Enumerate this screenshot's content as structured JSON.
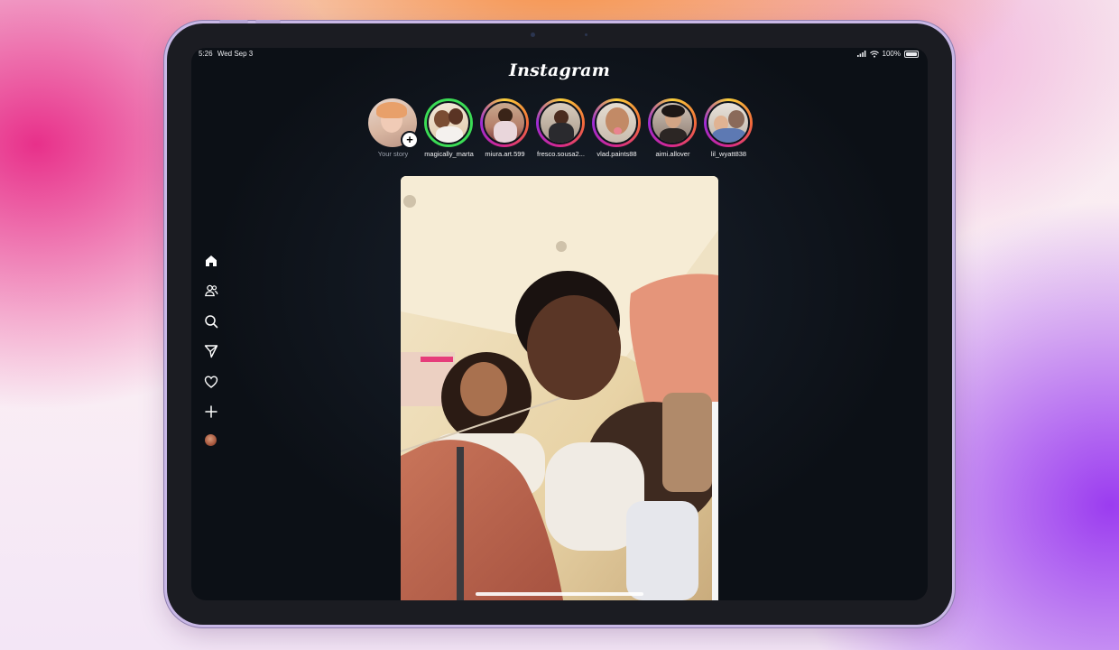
{
  "status_bar": {
    "time": "5:26",
    "date": "Wed Sep 3",
    "battery": "100%"
  },
  "app": {
    "logo": "Instagram"
  },
  "stories": [
    {
      "name": "Your story",
      "ring": "none",
      "self": true
    },
    {
      "name": "magically_marta",
      "ring": "close-friends"
    },
    {
      "name": "miura.art.599",
      "ring": "gradient"
    },
    {
      "name": "fresco.sousa2...",
      "ring": "gradient"
    },
    {
      "name": "vlad.paints88",
      "ring": "gradient"
    },
    {
      "name": "aimi.allover",
      "ring": "gradient"
    },
    {
      "name": "lil_wyatt838",
      "ring": "gradient"
    }
  ],
  "sidebar": {
    "items": [
      {
        "name": "home",
        "icon": "home-icon",
        "active": true
      },
      {
        "name": "following",
        "icon": "people-icon"
      },
      {
        "name": "search",
        "icon": "search-icon"
      },
      {
        "name": "messages",
        "icon": "send-icon"
      },
      {
        "name": "activity",
        "icon": "heart-icon"
      },
      {
        "name": "create",
        "icon": "plus-icon"
      },
      {
        "name": "profile",
        "icon": "avatar"
      }
    ]
  },
  "colors": {
    "background": "#0c1016",
    "story_ring_close_friends": "#3bdc55",
    "story_ring_gradient": [
      "#f9cf3a",
      "#f36b3a",
      "#d7288a",
      "#9d2bd6"
    ]
  }
}
